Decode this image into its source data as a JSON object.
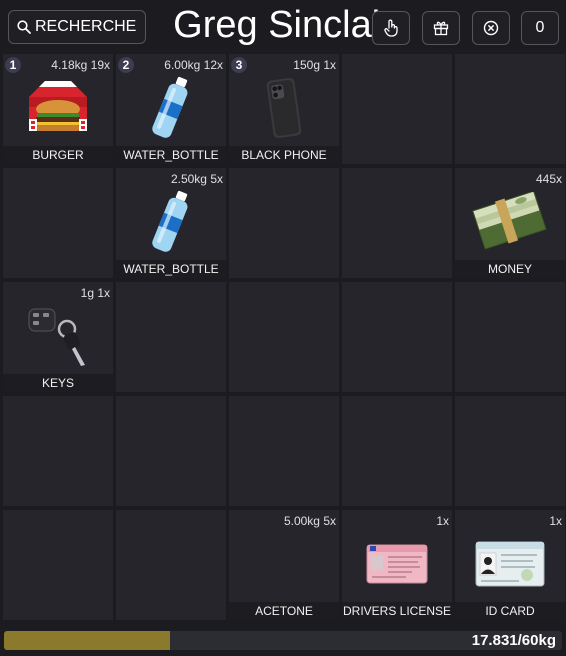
{
  "header": {
    "title": "Greg Sinclair",
    "search_placeholder": "RECHERCHE",
    "count_button_label": "0"
  },
  "colors": {
    "panel_bg": "#1b1b20",
    "slot_bg": "#25252b",
    "weight_fill": "#8c7a2c",
    "hotbar_badge": "#3c3c52"
  },
  "slots": [
    {
      "number": "1",
      "info": "4.18kg 19x",
      "label": "BURGER",
      "icon": "burger-icon"
    },
    {
      "number": "2",
      "info": "6.00kg 12x",
      "label": "WATER_BOTTLE",
      "icon": "water-bottle-icon"
    },
    {
      "number": "3",
      "info": "150g 1x",
      "label": "BLACK PHONE",
      "icon": "phone-icon"
    },
    {},
    {},
    {},
    {
      "info": "2.50kg 5x",
      "label": "WATER_BOTTLE",
      "icon": "water-bottle-icon"
    },
    {},
    {},
    {
      "info": "445x",
      "label": "MONEY",
      "icon": "money-icon"
    },
    {
      "info": "1g 1x",
      "label": "KEYS",
      "icon": "keys-icon"
    },
    {},
    {},
    {},
    {},
    {},
    {},
    {},
    {},
    {},
    {},
    {},
    {
      "info": "5.00kg 5x",
      "label": "ACETONE"
    },
    {
      "info": "1x",
      "label": "DRIVERS LICENSE",
      "icon": "license-icon"
    },
    {
      "info": "1x",
      "label": "ID CARD",
      "icon": "id-card-icon"
    }
  ],
  "weight": {
    "text": "17.831/60kg",
    "fraction": 0.297
  }
}
